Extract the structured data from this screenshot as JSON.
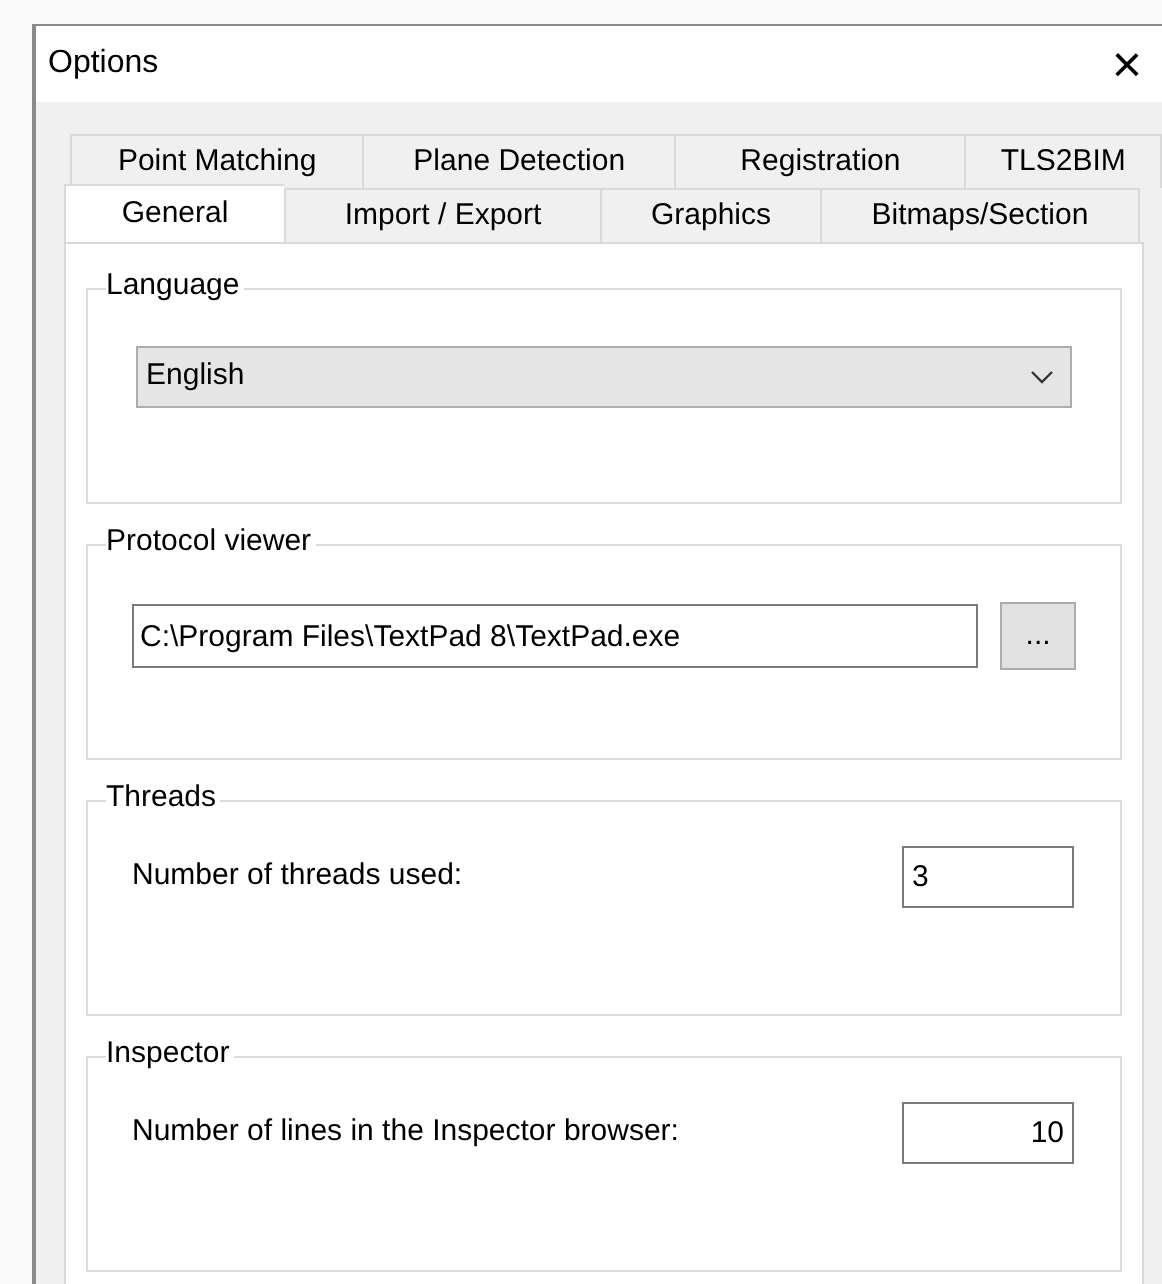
{
  "window": {
    "title": "Options",
    "close": "×"
  },
  "tab_rows": [
    [
      {
        "label": "Point Matching",
        "selected": false
      },
      {
        "label": "Plane Detection",
        "selected": false
      },
      {
        "label": "Registration",
        "selected": false
      },
      {
        "label": "TLS2BIM",
        "selected": false
      }
    ],
    [
      {
        "label": "General",
        "selected": true
      },
      {
        "label": "Import / Export",
        "selected": false
      },
      {
        "label": "Graphics",
        "selected": false
      },
      {
        "label": "Bitmaps/Section",
        "selected": false
      }
    ]
  ],
  "groups": [
    {
      "title": "Language",
      "kind": "dropdown",
      "value": "English"
    },
    {
      "title": "Protocol viewer",
      "kind": "file",
      "value": "C:\\Program Files\\TextPad 8\\TextPad.exe",
      "button": "..."
    },
    {
      "title": "Threads",
      "kind": "entry",
      "label": "Number of threads used:",
      "value": "3"
    },
    {
      "title": "Inspector",
      "kind": "number",
      "label": "Number of lines in the Inspector browser:",
      "value": "10"
    }
  ]
}
